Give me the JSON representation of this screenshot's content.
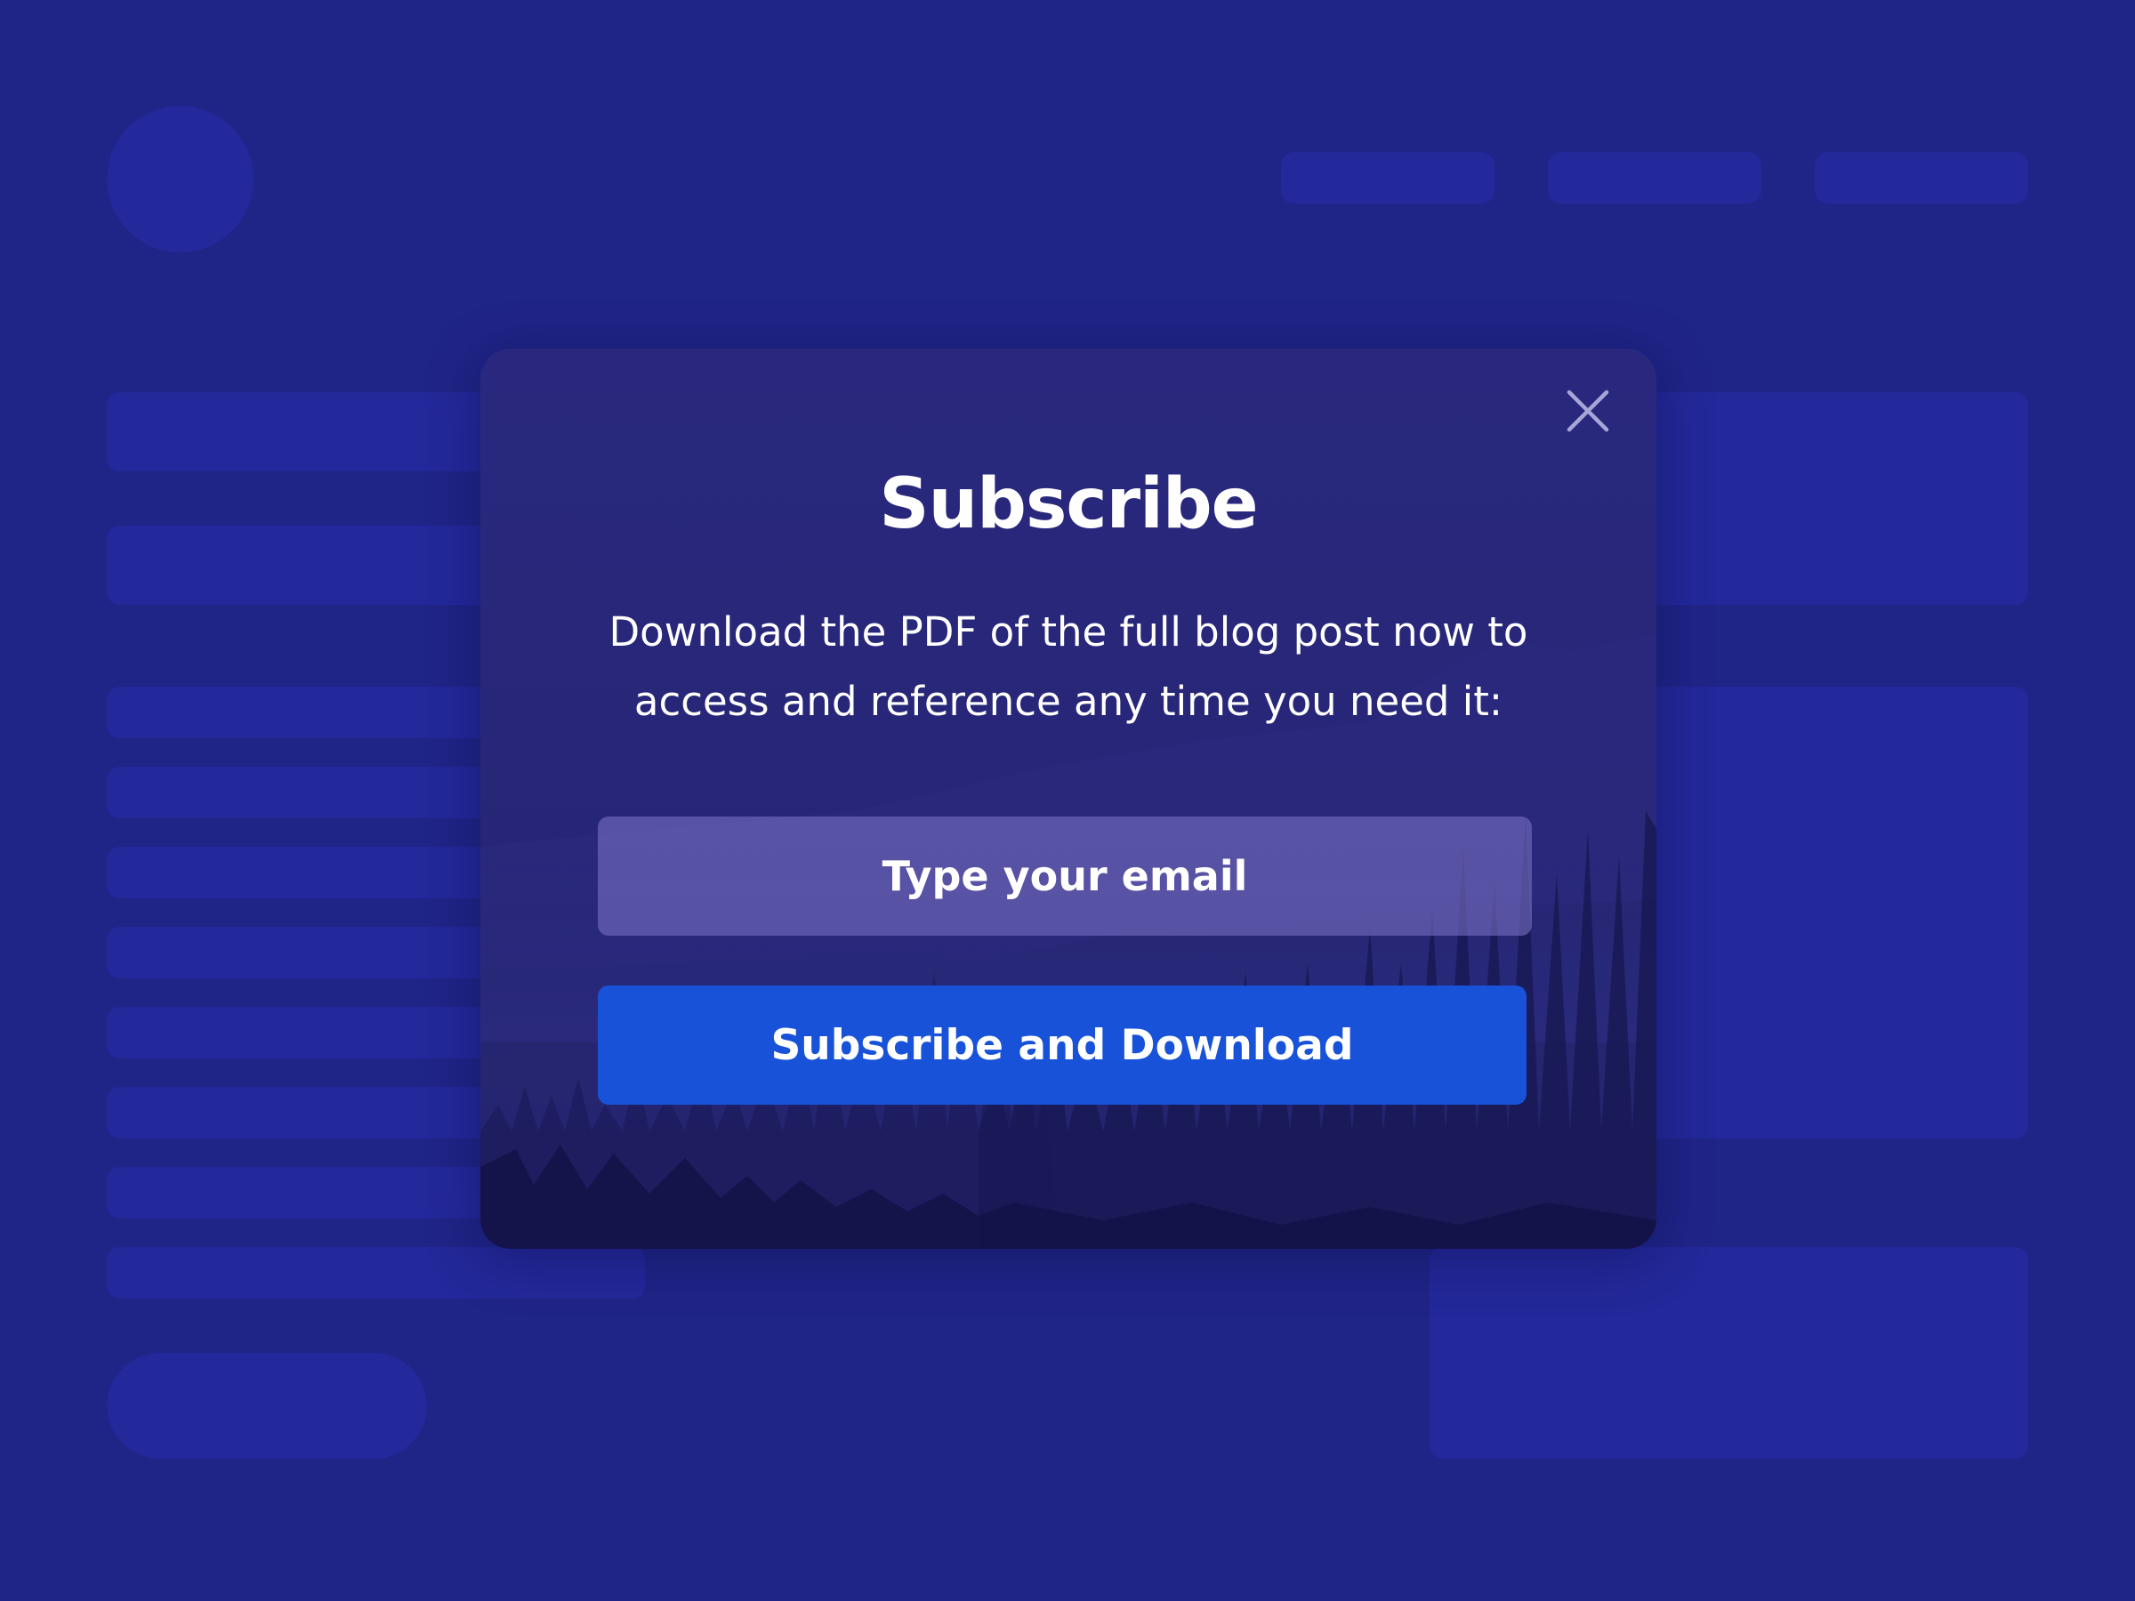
{
  "modal": {
    "title": "Subscribe",
    "description_line_1": "Download the PDF of the full blog post now to",
    "description_line_2": "access and reference any time you need it:",
    "close_icon": "close-icon",
    "email_input": {
      "placeholder": "Type your email",
      "value": ""
    },
    "submit_label": "Subscribe and Download"
  },
  "colors": {
    "page_background": "#1f2487",
    "skeleton_block": "#23289a",
    "modal_background": "#272676",
    "input_background": "#5a5698",
    "button_background": "#1752d8",
    "text": "#ffffff"
  }
}
